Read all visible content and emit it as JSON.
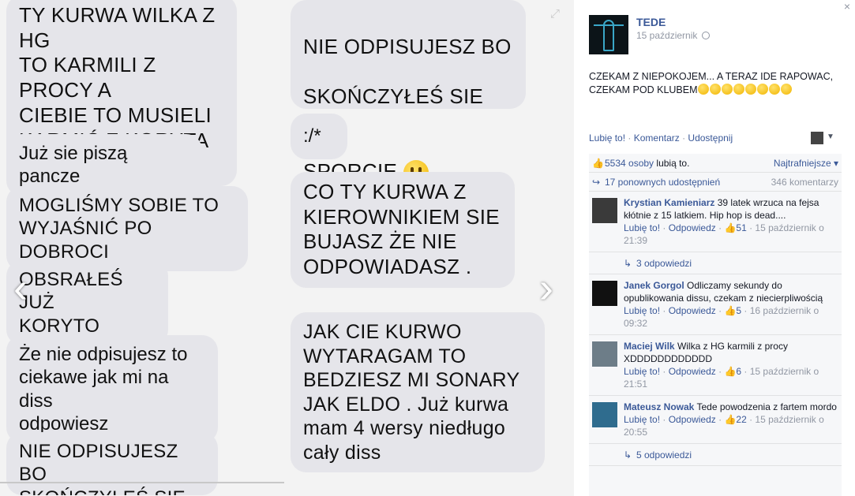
{
  "photo": {
    "left_messages": [
      {
        "text": "TY KURWA WILKA Z HG\nTO KARMILI Z PROCY A\nCIEBIE TO MUSIELI\nKARMIĆ Z KORYTA\nGRUBASIE."
      },
      {
        "text": "Już sie piszą pancze"
      },
      {
        "text": "MOGLIŚMY SOBIE TO\nWYJAŚNIĆ PO DOBROCI"
      },
      {
        "text": "OBSRAŁEŚ JUŻ\nKORYTO"
      },
      {
        "text": "Że nie odpisujesz to\nciekawe jak mi na diss\nodpowiesz"
      },
      {
        "text": "NIE ODPISUJESZ BO\nSKOŃCZYŁEŚ SIE NA"
      }
    ],
    "right_messages": [
      {
        "text_line1": "NIE ODPISUJESZ BO",
        "text_line2": "SKOŃCZYŁEŚ SIE NA",
        "text_line3": "SPORCIE"
      },
      {
        "text": ":/*"
      },
      {
        "text": "CO TY KURWA Z\nKIEROWNIKIEM SIE\nBUJASZ ŻE NIE\nODPOWIADASZ ."
      },
      {
        "text": "JAK CIE KURWO\nWYTARAGAM TO\nBEDZIESZ MI SONARY\nJAK ELDO . Już kurwa\nmam 4 wersy niedługo\ncały diss"
      }
    ],
    "prev_arrow": "‹",
    "next_arrow": "›",
    "expand_icon": "⤢"
  },
  "post": {
    "page_name": "TEDE",
    "date": "15 październik",
    "text": "CZEKAM Z NIEPOKOJEM... A TERAZ IDE RAPOWAC, CZEKAM POD KLUBEM",
    "actions": {
      "like": "Lubię to!",
      "comment": "Komentarz",
      "share": "Udostępnij"
    },
    "close": "×"
  },
  "ufi": {
    "likes_text": "5534 osoby",
    "likes_suffix": " lubią to.",
    "sort_label": "Najtrafniejsze",
    "shares_text": "17 ponownych udostępnień",
    "comments_count": "346 komentarzy"
  },
  "comments": [
    {
      "name": "Krystian Kamieniarz",
      "text": "39 latek wrzuca na fejsa kłótnie z 15 latkiem. Hip hop is dead....",
      "like": "Lubię to!",
      "reply": "Odpowiedz",
      "likes": "51",
      "time": "15 październik o 21:39",
      "replies": "3 odpowiedzi"
    },
    {
      "name": "Janek Gorgol",
      "text": "Odliczamy sekundy do opublikowania dissu, czekam z niecierpliwością",
      "like": "Lubię to!",
      "reply": "Odpowiedz",
      "likes": "5",
      "time": "16 październik o 09:32"
    },
    {
      "name": "Maciej Wilk",
      "text": "Wilka z HG karmili z procy XDDDDDDDDDDDD",
      "like": "Lubię to!",
      "reply": "Odpowiedz",
      "likes": "6",
      "time": "15 październik o 21:51"
    },
    {
      "name": "Mateusz Nowak",
      "text": "Tede powodzenia z fartem mordo",
      "like": "Lubię to!",
      "reply": "Odpowiedz",
      "likes": "22",
      "time": "15 październik o 20:55",
      "replies": "5 odpowiedzi"
    }
  ],
  "colors": {
    "link": "#3b5998",
    "muted": "#9197a3",
    "bubble": "#e5e5ea"
  }
}
